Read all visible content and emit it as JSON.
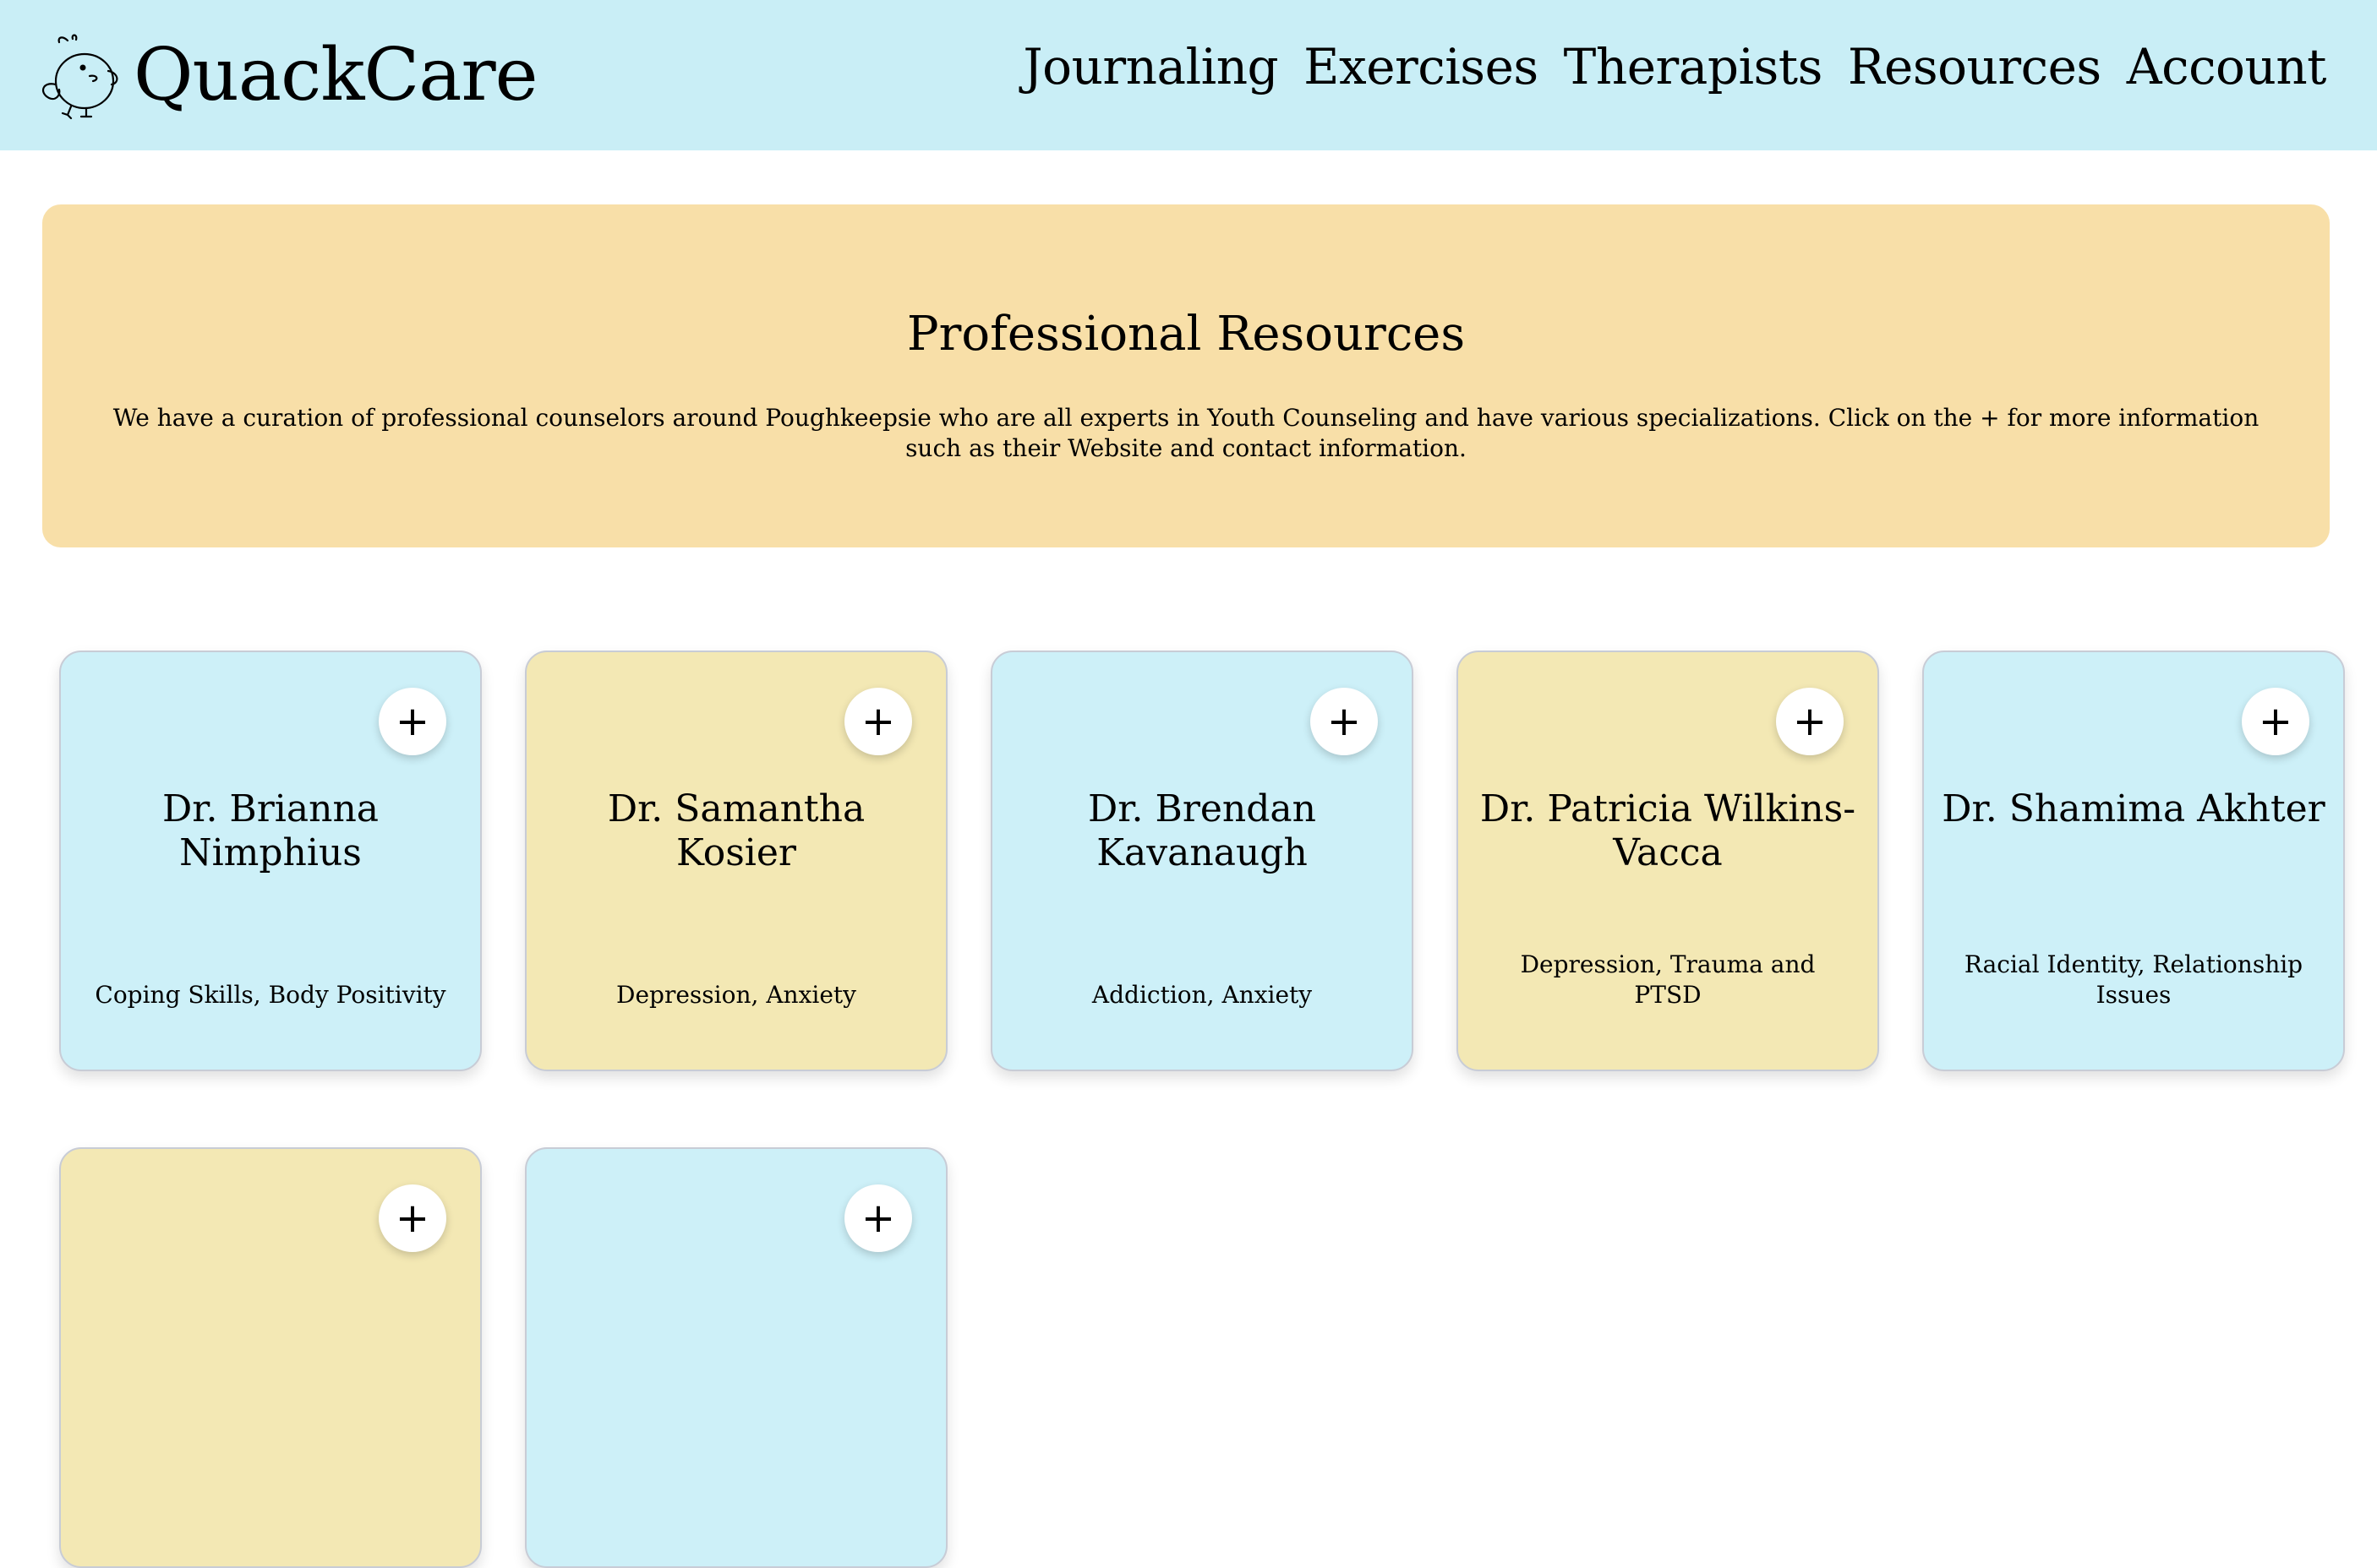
{
  "header": {
    "brand": "QuackCare",
    "nav": [
      "Journaling",
      "Exercises",
      "Therapists",
      "Resources",
      "Account"
    ]
  },
  "banner": {
    "title": "Professional Resources",
    "text": "We have a curation of professional counselors around Poughkeepsie who are all experts in Youth Counseling and have various specializations. Click on the + for more information such as their Website and contact information."
  },
  "cards": [
    {
      "name": "Dr. Brianna Nimphius",
      "specialties": "Coping Skills, Body Positivity",
      "color": "#cdf0f8"
    },
    {
      "name": "Dr. Samantha Kosier",
      "specialties": "Depression, Anxiety",
      "color": "#f3e8b4"
    },
    {
      "name": "Dr. Brendan Kavanaugh",
      "specialties": "Addiction, Anxiety",
      "color": "#cdf0f8"
    },
    {
      "name": "Dr. Patricia Wilkins-Vacca",
      "specialties": "Depression, Trauma and PTSD",
      "color": "#f3e8b4"
    },
    {
      "name": "Dr. Shamima Akhter",
      "specialties": "Racial Identity, Relationship Issues",
      "color": "#cdf0f8"
    },
    {
      "name": "",
      "specialties": "",
      "color": "#f3e8b4"
    },
    {
      "name": "",
      "specialties": "",
      "color": "#cdf0f8"
    }
  ],
  "plus_glyph": "+",
  "colors": {
    "header_bg": "#c9eef6",
    "banner_bg": "#f8dfa8",
    "card_blue": "#cdf0f8",
    "card_yellow": "#f3e8b4"
  }
}
